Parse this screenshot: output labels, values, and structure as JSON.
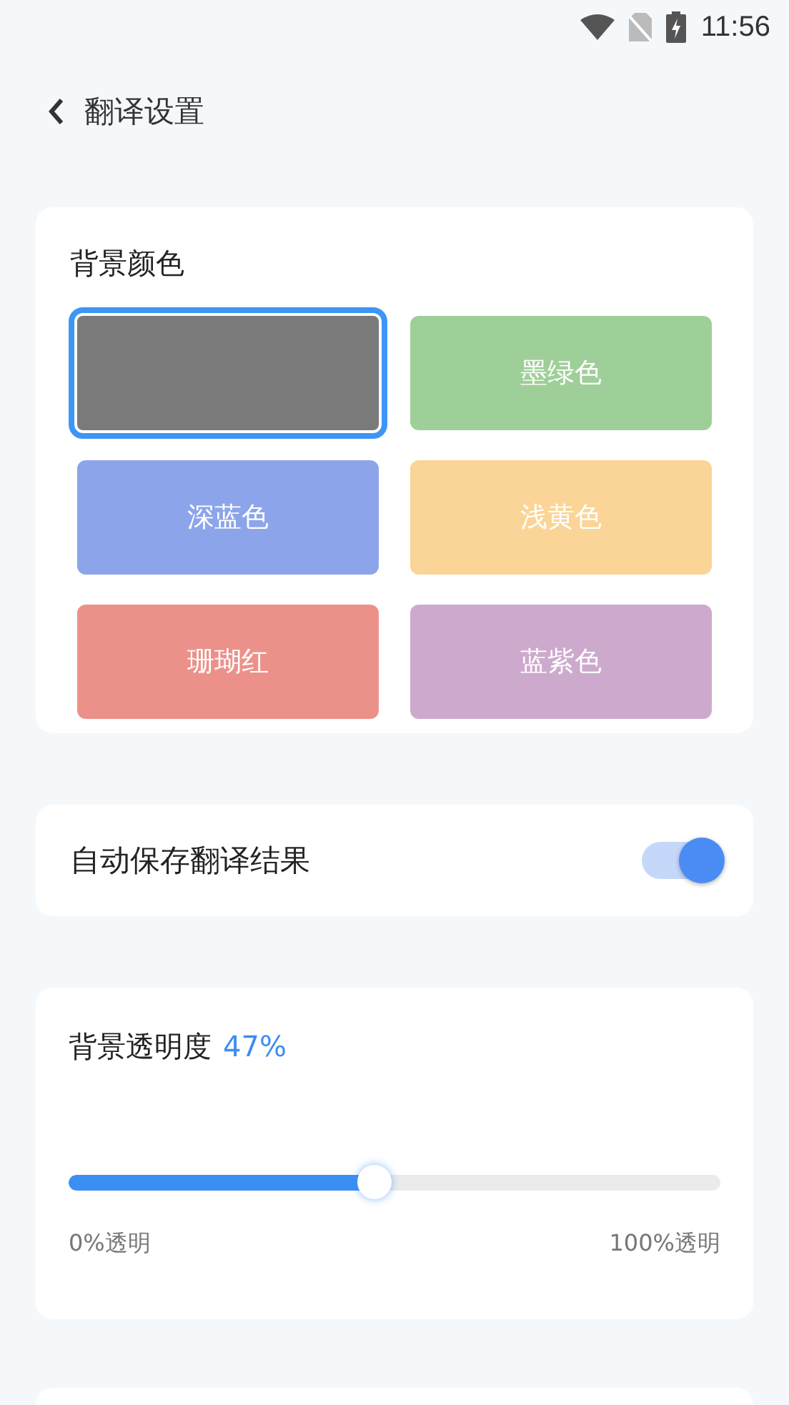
{
  "status_bar": {
    "time": "11:56"
  },
  "header": {
    "title": "翻译设置"
  },
  "background_color": {
    "title": "背景颜色",
    "swatches": [
      {
        "color": "#7a7a7a",
        "selected": true
      },
      {
        "label": "墨绿色",
        "color": "#9fcf98",
        "selected": false
      },
      {
        "label": "深蓝色",
        "color": "#8ca5ea",
        "selected": false
      },
      {
        "label": "浅黄色",
        "color": "#fbd597",
        "selected": false
      },
      {
        "label": "珊瑚红",
        "color": "#ec918a",
        "selected": false
      },
      {
        "label": "蓝紫色",
        "color": "#cdaacd",
        "selected": false
      }
    ]
  },
  "auto_save": {
    "label": "自动保存翻译结果",
    "on": true
  },
  "opacity": {
    "title": "背景透明度",
    "reading": "47%",
    "level": 0.47,
    "min_label": "0%透明",
    "max_label": "100%透明"
  }
}
